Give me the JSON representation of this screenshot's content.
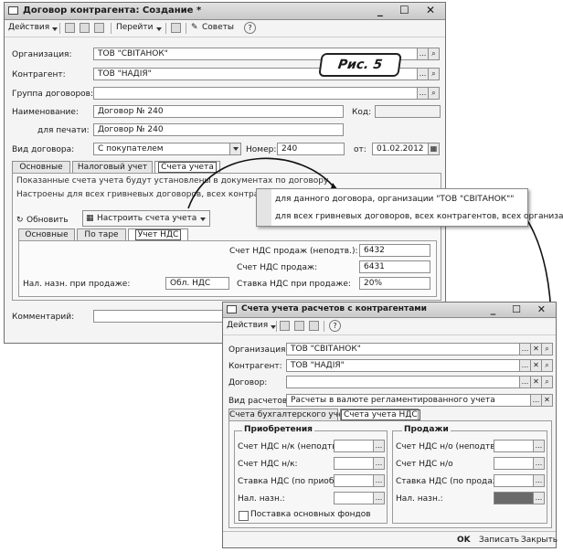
{
  "main_window": {
    "title": "Договор контрагента: Создание *",
    "window_controls": "_ ☐ ✕",
    "toolbar": {
      "actions": "Действия",
      "goto": "Перейти",
      "tips": "Советы"
    },
    "fields": {
      "organization_label": "Организация:",
      "organization_value": "ТОВ \"СВІТАНОК\"",
      "counterparty_label": "Контрагент:",
      "counterparty_value": "ТОВ \"НАДІЯ\"",
      "group_label": "Группа договоров:",
      "group_value": "",
      "name_label": "Наименование:",
      "name_value": "Договор № 240",
      "code_label": "Код:",
      "code_value": "",
      "print_label": "для печати:",
      "print_value": "Договор № 240",
      "type_label": "Вид договора:",
      "type_value": "С покупателем",
      "number_label": "Номер:",
      "number_value": "240",
      "from_label": "от:",
      "date_value": "01.02.2012"
    },
    "tabs": [
      "Основные",
      "Налоговый учет",
      "Счета учета"
    ],
    "info_line1": "Показанные счета учета будут установлены в документах по договору.",
    "info_line2": "Настроены для всех гривневых договоров, всех контрагентов, всех организаций",
    "refresh_button": "Обновить",
    "setup_button": "Настроить счета учета",
    "subtabs": [
      "Основные",
      "По таре",
      "Учет НДС"
    ],
    "vat": {
      "unconfirmed_label": "Счет НДС продаж (неподтв.):",
      "unconfirmed_value": "6432",
      "sales_label": "Счет НДС продаж:",
      "sales_value": "6431",
      "rate_label": "Ставка НДС при продаже:",
      "rate_value": "20%",
      "tax_purpose_label": "Нал. назн. при продаже:",
      "tax_purpose_value": "Обл. НДС"
    },
    "comment_label": "Комментарий:"
  },
  "figure_caption": "Рис. 5",
  "popup_menu": {
    "items": [
      "для данного договора, организации \"ТОВ \"СВІТАНОК\"\"",
      "для всех гривневых договоров, всех контрагентов, всех организаций"
    ]
  },
  "second_window": {
    "title": "Счета учета расчетов с контрагентами",
    "window_controls": "_ ☐ ✕",
    "toolbar": {
      "actions": "Действия"
    },
    "fields": {
      "organization_label": "Организация:",
      "organization_value": "ТОВ \"СВІТАНОК\"",
      "counterparty_label": "Контрагент:",
      "counterparty_value": "ТОВ \"НАДІЯ\"",
      "contract_label": "Договор:",
      "contract_value": "",
      "settle_label": "Вид расчетов:",
      "settle_value": "Расчеты в валюте регламентированного учета"
    },
    "tabs": [
      "Счета бухгалтерского учета",
      "Счета учета НДС"
    ],
    "purchases": {
      "title": "Приобретения",
      "rows": [
        "Счет НДС н/к (неподтв.):",
        "Счет НДС н/к:",
        "Ставка НДС (по приобре...",
        "Нал. назн.:"
      ],
      "checkbox": "Поставка основных фондов"
    },
    "sales": {
      "title": "Продажи",
      "rows": [
        "Счет НДС н/о (неподтв.):",
        "Счет НДС н/о",
        "Ставка НДС (по продаже):",
        "Нал. назн.:"
      ]
    },
    "footer": {
      "ok": "OK",
      "save": "Записать",
      "close": "Закрыть"
    }
  }
}
